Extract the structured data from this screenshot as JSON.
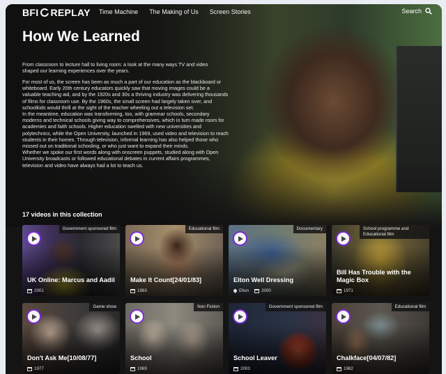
{
  "nav": {
    "logo_left": "BFI",
    "logo_right": "REPLAY",
    "links": [
      "Time Machine",
      "The Making of Us",
      "Screen Stories"
    ],
    "search_label": "Search",
    "search_icon": "search-icon"
  },
  "hero": {
    "title": "How We Learned",
    "intro": "From classroom to lecture hall to living room: a look at the many ways TV and video shaped our learning experiences over the years.",
    "paragraphs": [
      "For most of us, the screen has been as much a part of our education as the blackboard or whiteboard. Early 20th century educators quickly saw that moving images could be a valuable teaching aid, and by the 1920s and 30s a thriving industry was delivering thousands of films for classroom use. By the 1960s, the small screen had largely taken over, and schoolkids would thrill at the sight of the teacher wheeling out a television set.",
      "In the meantime, education was transforming, too, with grammar schools, secondary moderns and technical schools giving way to comprehensives, which in turn made room for academies and faith schools. Higher education swelled with new universities and polytechnics, while the Open University, launched in 1969, used video and television to reach students in their homes. Through television, informal learning has also helped those who missed out on traditional schooling, or who just want to expand their minds.",
      "Whether we spoke our first words along with onscreen puppets, studied along with Open University broadcasts or followed educational debates in current affairs programmes, television and video have always had a lot to teach us."
    ]
  },
  "collection": {
    "count_label": "17 videos in this collection",
    "accent_color": "#7c2bd6",
    "videos": [
      {
        "title": "UK Online: Marcus and Aadil",
        "category": "Government sponsored film",
        "year": "2001",
        "location": ""
      },
      {
        "title": "Make It Count[24/01/83]",
        "category": "Educational film",
        "year": "1983",
        "location": ""
      },
      {
        "title": "Elton Well Dressing",
        "category": "Documentary",
        "year": "2000",
        "location": "Elton"
      },
      {
        "title": "Bill Has Trouble with the Magic Box",
        "category": "School programme and Educational film",
        "year": "1971",
        "location": ""
      },
      {
        "title": "Don't Ask Me[10/08/77]",
        "category": "Game show",
        "year": "1977",
        "location": ""
      },
      {
        "title": "School",
        "category": "Non Fiction",
        "year": "1969",
        "location": ""
      },
      {
        "title": "School Leaver",
        "category": "Government sponsored film",
        "year": "2003",
        "location": ""
      },
      {
        "title": "Chalkface[04/07/82]",
        "category": "Educational film",
        "year": "1982",
        "location": ""
      }
    ]
  }
}
